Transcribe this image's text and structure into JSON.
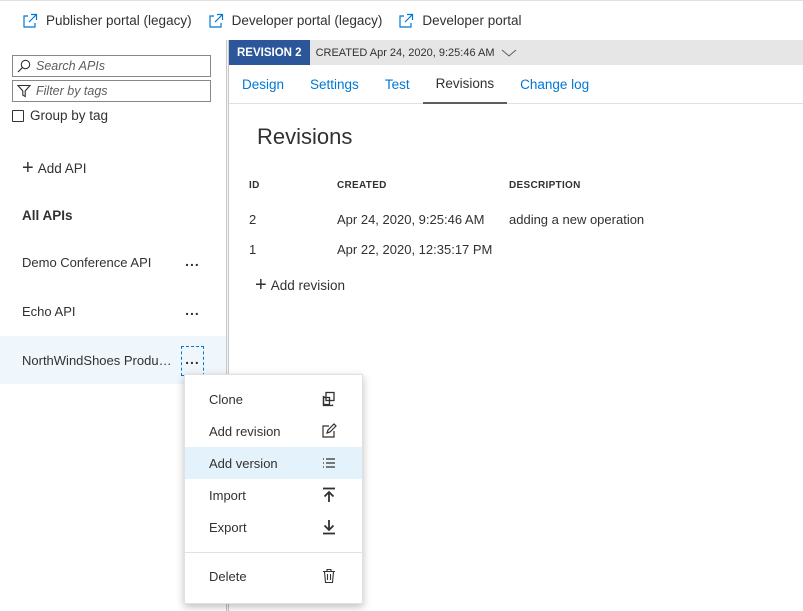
{
  "topbar": {
    "links": [
      {
        "label": "Publisher portal (legacy)"
      },
      {
        "label": "Developer portal (legacy)"
      },
      {
        "label": "Developer portal"
      }
    ]
  },
  "sidebar": {
    "search_placeholder": "Search APIs",
    "filter_placeholder": "Filter by tags",
    "group_by_label": "Group by tag",
    "add_api_label": "Add API",
    "all_apis_label": "All APIs",
    "apis": [
      {
        "label": "Demo Conference API",
        "selected": false
      },
      {
        "label": "Echo API",
        "selected": false
      },
      {
        "label": "NorthWindShoes Products",
        "selected": true
      }
    ],
    "more_label": "..."
  },
  "revision_bar": {
    "badge": "REVISION 2",
    "created": "CREATED Apr 24, 2020, 9:25:46 AM"
  },
  "tabs": [
    {
      "label": "Design",
      "active": false
    },
    {
      "label": "Settings",
      "active": false
    },
    {
      "label": "Test",
      "active": false
    },
    {
      "label": "Revisions",
      "active": true
    },
    {
      "label": "Change log",
      "active": false
    }
  ],
  "main": {
    "title": "Revisions",
    "columns": {
      "id": "ID",
      "created": "CREATED",
      "description": "DESCRIPTION"
    },
    "rows": [
      {
        "id": "2",
        "created": "Apr 24, 2020, 9:25:46 AM",
        "description": "adding a new operation"
      },
      {
        "id": "1",
        "created": "Apr 22, 2020, 12:35:17 PM",
        "description": ""
      }
    ],
    "add_revision_label": "Add revision"
  },
  "context_menu": {
    "items": [
      {
        "label": "Clone",
        "icon": "clone-icon"
      },
      {
        "label": "Add revision",
        "icon": "edit-icon"
      },
      {
        "label": "Add version",
        "icon": "list-icon",
        "hover": true
      },
      {
        "label": "Import",
        "icon": "upload-icon"
      },
      {
        "label": "Export",
        "icon": "download-icon"
      },
      {
        "label": "Delete",
        "icon": "trash-icon"
      }
    ]
  },
  "colors": {
    "accent": "#0078d4",
    "revision_badge": "#2b579a",
    "selected_bg": "#eff6fc",
    "hover_bg": "#e4f2fb"
  }
}
